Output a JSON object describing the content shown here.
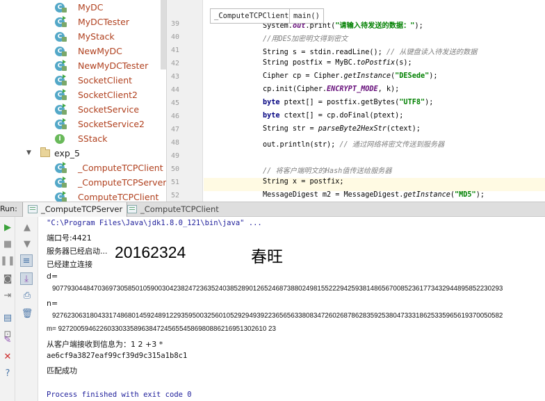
{
  "tree": {
    "items": [
      {
        "name": "MyDC",
        "badge": "C",
        "indent": 1,
        "run": false
      },
      {
        "name": "MyDCTester",
        "badge": "C",
        "indent": 1,
        "run": true
      },
      {
        "name": "MyStack",
        "badge": "C",
        "indent": 1,
        "run": false
      },
      {
        "name": "NewMyDC",
        "badge": "C",
        "indent": 1,
        "run": false
      },
      {
        "name": "NewMyDCTester",
        "badge": "C",
        "indent": 1,
        "run": true
      },
      {
        "name": "SocketClient",
        "badge": "C",
        "indent": 1,
        "run": true
      },
      {
        "name": "SocketClient2",
        "badge": "C",
        "indent": 1,
        "run": true
      },
      {
        "name": "SocketService",
        "badge": "C",
        "indent": 1,
        "run": true
      },
      {
        "name": "SocketService2",
        "badge": "C",
        "indent": 1,
        "run": true
      },
      {
        "name": "SStack",
        "badge": "I",
        "indent": 1,
        "run": false
      },
      {
        "name": "exp_5",
        "folder": true,
        "indent": 0
      },
      {
        "name": "_ComputeTCPClient",
        "badge": "C",
        "indent": 1,
        "run": true
      },
      {
        "name": "_ComputeTCPServer",
        "badge": "C",
        "indent": 1,
        "run": true
      },
      {
        "name": "ComputeTCPClient",
        "badge": "C",
        "indent": 1,
        "run": true
      }
    ]
  },
  "editor": {
    "crumbs": [
      "_ComputeTCPClient",
      "main()"
    ],
    "lines": [
      {
        "n": "39",
        "html": "System.<span class=\"fld\">out</span>.print(<span class=\"str\">\"请输入待发送的数据：\"</span>);"
      },
      {
        "n": "40",
        "html": "<span class=\"cm\">//用DES加密明文得到密文</span>"
      },
      {
        "n": "41",
        "html": "String s = stdin.readLine(); <span class=\"cm\">// 从键盘读入待发送的数据</span>"
      },
      {
        "n": "42",
        "html": "String postfix = MyBC.<span class=\"it\">toPostfix</span>(s);"
      },
      {
        "n": "43",
        "html": "Cipher cp = Cipher.<span class=\"it\">getInstance</span>(<span class=\"str\">\"DESede\"</span>);"
      },
      {
        "n": "44",
        "html": "cp.init(Cipher.<span class=\"fld\">ENCRYPT_MODE</span>, k);"
      },
      {
        "n": "45",
        "html": "<span class=\"kw\">byte</span> ptext[] = postfix.getBytes(<span class=\"str\">\"UTF8\"</span>);"
      },
      {
        "n": "46",
        "html": "<span class=\"kw\">byte</span> ctext[] = cp.doFinal(ptext);"
      },
      {
        "n": "47",
        "html": "String str = <span class=\"it\">parseByte2HexStr</span>(ctext);"
      },
      {
        "n": "48",
        "html": "out.println(str); <span class=\"cm\">// 通过网络将密文传送到服务器</span>"
      },
      {
        "n": "49",
        "html": ""
      },
      {
        "n": "50",
        "html": "<span class=\"cm\">// 将客户端明文的Hash值传送给服务器</span>"
      },
      {
        "n": "51",
        "html": "String x = postfix;"
      },
      {
        "n": "52",
        "html": "MessageDigest m2 = MessageDigest.<span class=\"it\">getInstance</span>(<span class=\"str\">\"MD5\"</span>);"
      }
    ]
  },
  "run": {
    "label": "Run:",
    "tabs": [
      {
        "label": "_ComputeTCPServer",
        "active": true
      },
      {
        "label": "_ComputeTCPClient",
        "active": false
      }
    ]
  },
  "console": {
    "java_path": "\"C:\\Program Files\\Java\\jdk1.8.0_121\\bin\\java\" ...",
    "port": "端口号:4421",
    "server_started": "服务器已经启动...",
    "overlay_id": "20162324",
    "overlay_name": "春旺",
    "connected": "已经建立连接",
    "d_label": "d=",
    "d_value": "90779304484703697305850105900304238247236352403852890126524687388024981552229425938148656700852361773432944895852230293",
    "n_label": "n=",
    "n_value": "92762306318043317486801459248912293595003256010529294939223656563380834726026878628359253804733318625335965619370050582",
    "m_line": "m= 9272005946226033033589638472456554586980886216951302610 23",
    "received": "从客户端接收到信息为：1 2 +3 *",
    "hash": "ae6cf9a3827eaf99cf39d9c315a1b8c1",
    "match": "匹配成功",
    "finished": "Process finished with exit code 0"
  },
  "colors": {
    "class_name": "#b0401e",
    "class_badge": "#53a8c8",
    "interface_badge": "#69b95a",
    "console_link": "#1d1d9a",
    "current_line": "#fffae3"
  }
}
